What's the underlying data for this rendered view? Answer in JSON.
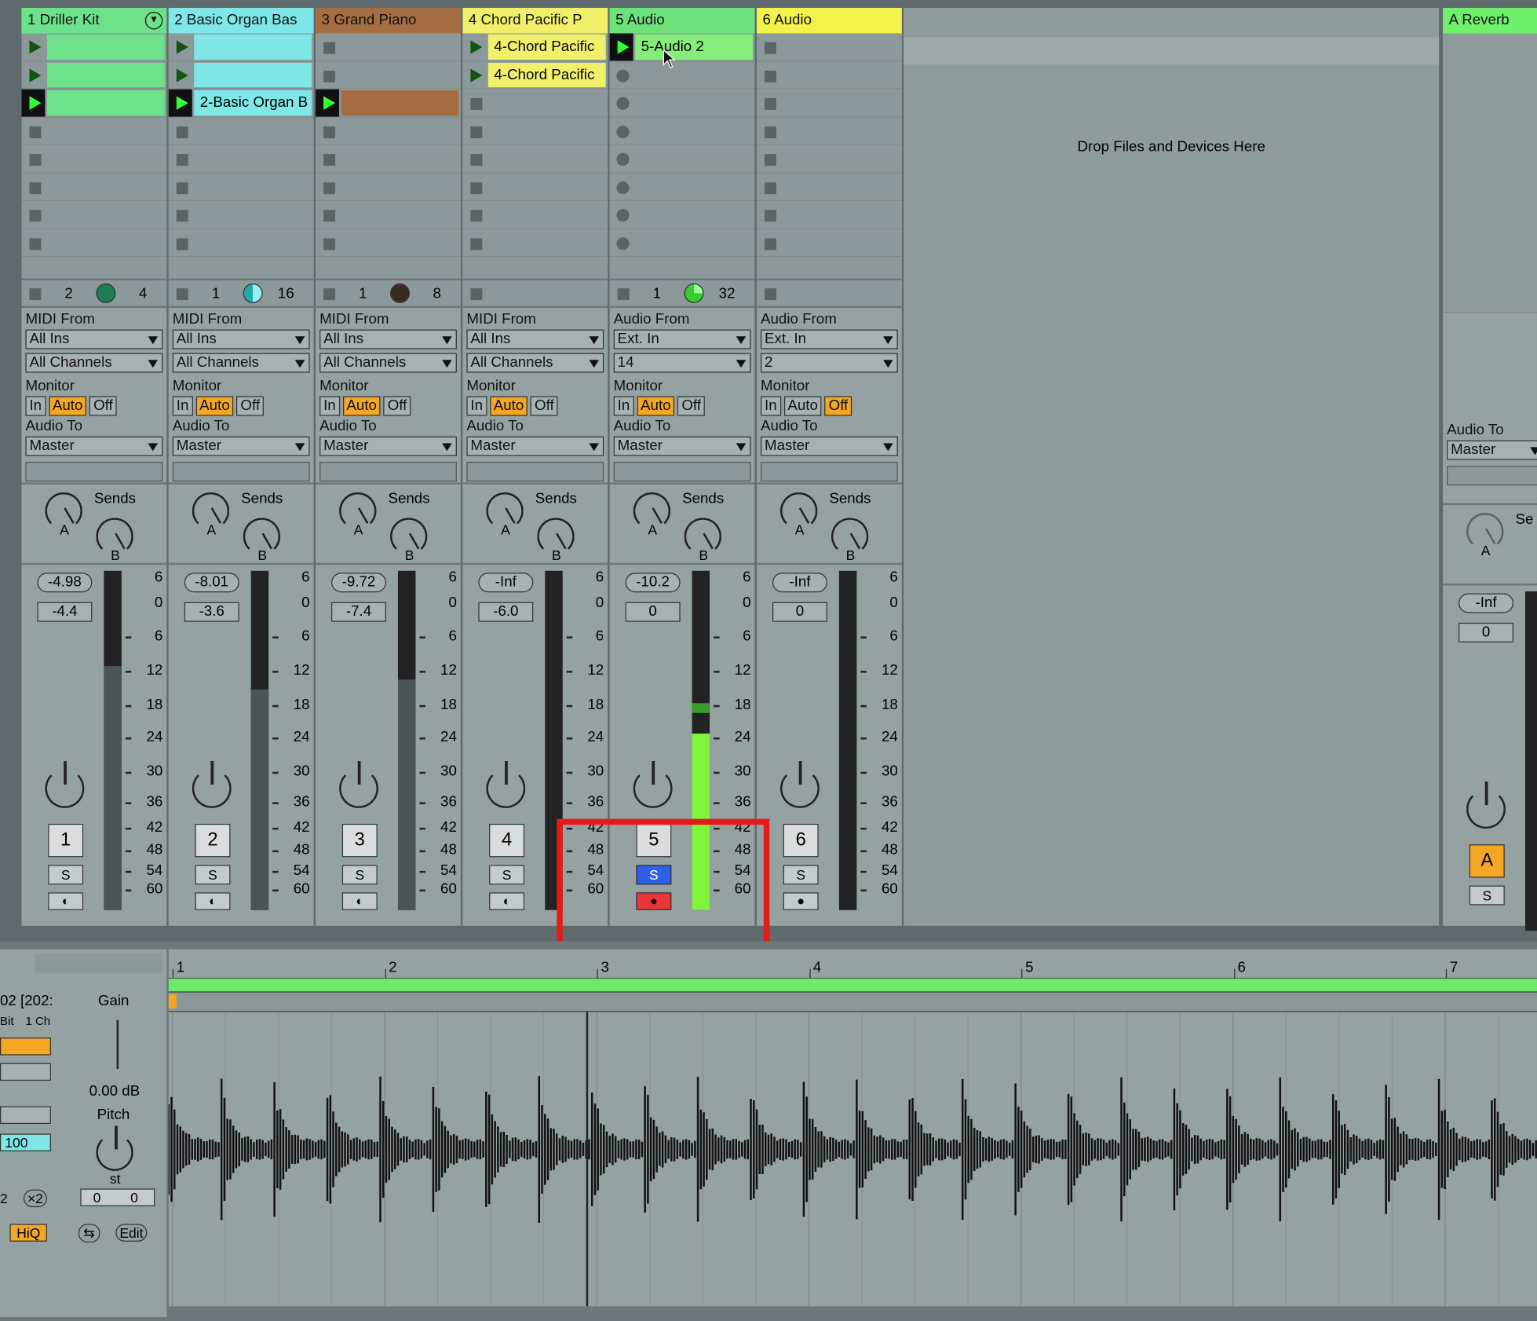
{
  "tracks": [
    {
      "name": "1 Driller Kit",
      "color": "#6ee28a",
      "input_label": "MIDI From",
      "input": "All Ins",
      "channel": "All Channels",
      "monitor": [
        "In",
        "Auto",
        "Off"
      ],
      "monitor_active": "Auto",
      "output_label": "Audio To",
      "output": "Master",
      "vol": "-4.98",
      "vol2": "-4.4",
      "num": "1",
      "status_a": "2",
      "status_b": "4"
    },
    {
      "name": "2 Basic Organ Bas",
      "color": "#7fe7e7",
      "input_label": "MIDI From",
      "input": "All Ins",
      "channel": "All Channels",
      "monitor": [
        "In",
        "Auto",
        "Off"
      ],
      "monitor_active": "Auto",
      "output_label": "Audio To",
      "output": "Master",
      "vol": "-8.01",
      "vol2": "-3.6",
      "num": "2",
      "status_a": "1",
      "status_b": "16"
    },
    {
      "name": "3 Grand Piano",
      "color": "#a46e42",
      "input_label": "MIDI From",
      "input": "All Ins",
      "channel": "All Channels",
      "monitor": [
        "In",
        "Auto",
        "Off"
      ],
      "monitor_active": "Auto",
      "output_label": "Audio To",
      "output": "Master",
      "vol": "-9.72",
      "vol2": "-7.4",
      "num": "3",
      "status_a": "1",
      "status_b": "8"
    },
    {
      "name": "4 Chord Pacific P",
      "color": "#f0f06a",
      "input_label": "MIDI From",
      "input": "All Ins",
      "channel": "All Channels",
      "monitor": [
        "In",
        "Auto",
        "Off"
      ],
      "monitor_active": "Auto",
      "output_label": "Audio To",
      "output": "Master",
      "vol": "-Inf",
      "vol2": "-6.0",
      "num": "4",
      "status_a": "",
      "status_b": ""
    },
    {
      "name": "5 Audio",
      "color": "#6ee27a",
      "input_label": "Audio From",
      "input": "Ext. In",
      "channel": "14",
      "monitor": [
        "In",
        "Auto",
        "Off"
      ],
      "monitor_active": "Auto",
      "output_label": "Audio To",
      "output": "Master",
      "vol": "-10.2",
      "vol2": "0",
      "num": "5",
      "status_a": "1",
      "status_b": "32"
    },
    {
      "name": "6 Audio",
      "color": "#f3f24a",
      "input_label": "Audio From",
      "input": "Ext. In",
      "channel": "2",
      "monitor": [
        "In",
        "Auto",
        "Off"
      ],
      "monitor_active": "Off",
      "output_label": "Audio To",
      "output": "Master",
      "vol": "-Inf",
      "vol2": "0",
      "num": "6",
      "status_a": "",
      "status_b": ""
    }
  ],
  "clips": {
    "t1": [
      "",
      "",
      ""
    ],
    "t2": [
      "",
      "",
      "2-Basic Organ B"
    ],
    "t4": [
      "4-Chord Pacific",
      "4-Chord Pacific"
    ],
    "t5": [
      "5-Audio 2"
    ]
  },
  "sends_label": "Sends",
  "send_a": "A",
  "send_b": "B",
  "solo_label": "S",
  "drop_text": "Drop Files and Devices Here",
  "return_track": {
    "name": "A Reverb",
    "color": "#6ef06a",
    "output_label": "Audio To",
    "output": "Master",
    "vol": "-Inf",
    "vol2": "0",
    "num": "A",
    "sends_partial": "Se"
  },
  "meter_scale": [
    "6",
    "0",
    "6",
    "12",
    "18",
    "24",
    "30",
    "36",
    "42",
    "48",
    "54",
    "60"
  ],
  "ruler": [
    "1",
    "2",
    "3",
    "4",
    "5",
    "6",
    "7"
  ],
  "clip_panel": {
    "name_partial": "02 [202:",
    "bit": "Bit",
    "ch": "1 Ch",
    "gain_label": "Gain",
    "gain_value": "0.00 dB",
    "pitch_label": "Pitch",
    "pitch_unit": "st",
    "pitch_a": "0",
    "pitch_b": "0",
    "val100": "100",
    "half": "2",
    "double": "×2",
    "hiq": "HiQ",
    "edit": "Edit"
  }
}
